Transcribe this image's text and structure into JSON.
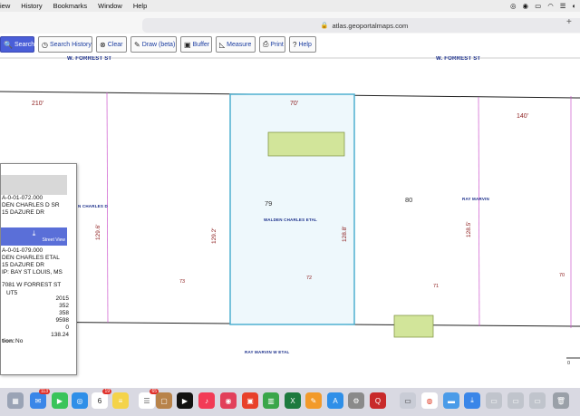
{
  "menubar": {
    "items": [
      "iew",
      "History",
      "Bookmarks",
      "Window",
      "Help"
    ]
  },
  "browser": {
    "url": "atlas.geoportalmaps.com",
    "new_tab": "+"
  },
  "toolbar": {
    "search": "Search",
    "search_history": "Search History",
    "clear": "Clear",
    "draw": "Draw (beta)",
    "buffer": "Buffer",
    "measure": "Measure",
    "print": "Print",
    "help": "Help"
  },
  "map": {
    "street_top_left": "W. FORREST ST",
    "street_top_right": "W. FORREST ST",
    "dim_210": "210'",
    "dim_70": "70'",
    "dim_140": "140'",
    "lot_79": "79",
    "lot_80": "80",
    "owner_center": "WALDEN CHARLES ETAL",
    "owner_right": "RAY MARVIN",
    "owner_left": "N CHARLES D",
    "owner_bottom": "RAY MARVIN W ETAL",
    "vdim_1": "129.6'",
    "vdim_2": "129.2'",
    "vdim_3": "128.8'",
    "vdim_4": "128.5'",
    "parcel_73": "73",
    "parcel_72": "72",
    "parcel_71": "71",
    "parcel_70": "70",
    "scale": "0"
  },
  "panel": {
    "parcel1": "A-0-01-072.000",
    "owner1": "DEN CHARLES D SR",
    "addr1": "15 DAZURE DR",
    "street_view": "Street View",
    "parcel2": "A-0-01-079.000",
    "owner2": "DEN CHARLES ETAL",
    "addr2": "15 DAZURE DR",
    "city": "IP:  BAY ST LOUIS, MS",
    "location": "7081 W FORREST ST",
    "zone": "UT5",
    "v1": "2015",
    "v2": "352",
    "v3": "358",
    "v4": "9598",
    "v5": "0",
    "v6": "138.24",
    "exempt_label": "tion:",
    "exempt_value": "No"
  },
  "dock": {
    "mail_badge": "113",
    "calendar_day": "6",
    "calendar_badge": "19",
    "notes_badge": "65"
  }
}
